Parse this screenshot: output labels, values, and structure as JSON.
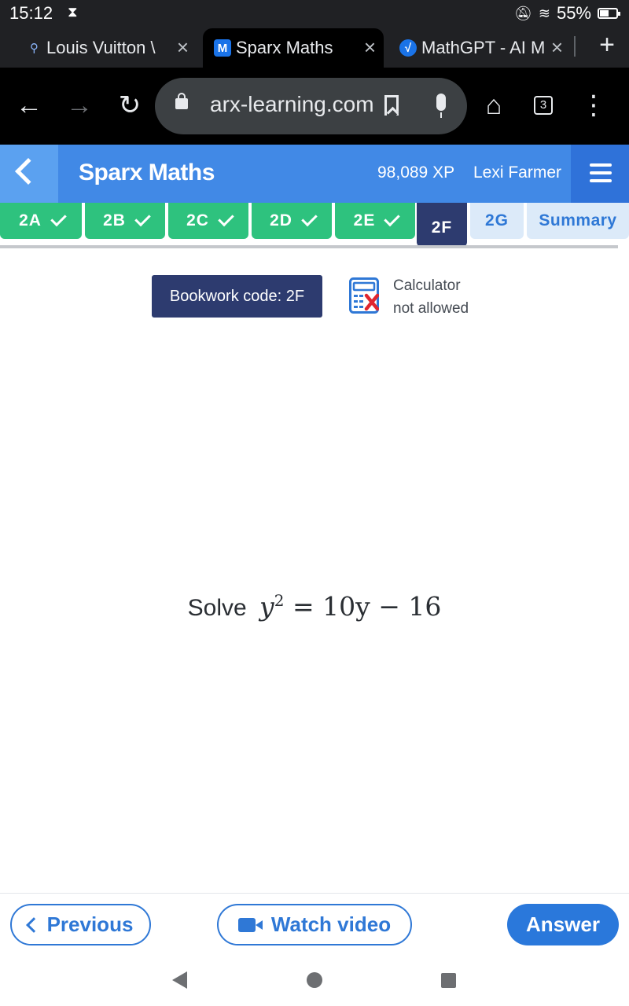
{
  "status_bar": {
    "time": "15:12",
    "battery_text": "55%",
    "battery_level": 0.55
  },
  "browser": {
    "tabs": [
      {
        "title": "Louis Vuitton \\",
        "favicon": "search-favicon",
        "active": false
      },
      {
        "title": "Sparx Maths",
        "favicon": "M",
        "active": true
      },
      {
        "title": "MathGPT - AI M",
        "favicon": "√",
        "active": false
      }
    ],
    "url": "arx-learning.com",
    "tab_count": "3"
  },
  "sparx": {
    "brand": "Sparx Maths",
    "xp": "98,089 XP",
    "user": "Lexi Farmer",
    "tasks": [
      {
        "label": "2A",
        "state": "done"
      },
      {
        "label": "2B",
        "state": "done"
      },
      {
        "label": "2C",
        "state": "done"
      },
      {
        "label": "2D",
        "state": "done"
      },
      {
        "label": "2E",
        "state": "done"
      },
      {
        "label": "2F",
        "state": "current"
      },
      {
        "label": "2G",
        "state": "todo"
      },
      {
        "label": "Summary",
        "state": "todo"
      }
    ],
    "bookwork_code": "Bookwork code: 2F",
    "calculator_line1": "Calculator",
    "calculator_line2": "not allowed",
    "question": {
      "word": "Solve",
      "lhs_var": "y",
      "lhs_exp": "2",
      "rhs": "= 10y − 16"
    },
    "buttons": {
      "previous": "Previous",
      "watch_video": "Watch video",
      "answer": "Answer"
    }
  },
  "colors": {
    "header_blue": "#4189e6",
    "done_green": "#2ec27e",
    "current_navy": "#2d3b6f",
    "accent_blue": "#2a78db",
    "calc_red": "#e0262f"
  }
}
